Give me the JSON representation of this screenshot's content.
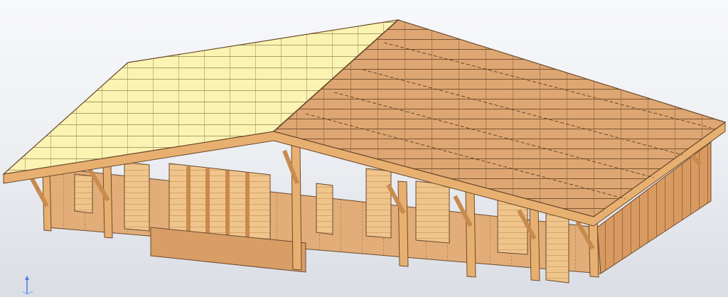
{
  "viewport": {
    "model": "timber-frame-house",
    "view": "isometric-3d",
    "colors": {
      "background_top": "#f7f8fb",
      "background_bottom": "#dadde4",
      "roof_left": "#fbf3b2",
      "roof_right": "#dea673",
      "wall_front": "#e2ad78",
      "wall_side": "#d99a61",
      "trim": "#e8b070",
      "edge": "#6b4a2d",
      "openings": "#f0c58c",
      "axis_blue": "#4a7de0"
    },
    "icons": [
      "axis-triad-icon"
    ]
  }
}
